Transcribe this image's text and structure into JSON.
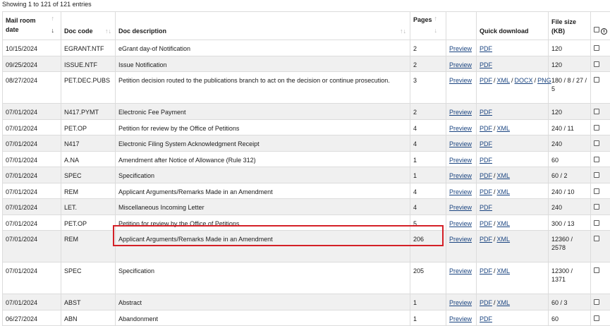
{
  "summary": "Showing 1 to 121 of 121 entries",
  "headers": {
    "mail_room_date": "Mail room date",
    "doc_code": "Doc code",
    "doc_description": "Doc description",
    "pages": "Pages",
    "quick_download": "Quick download",
    "file_size": "File size (KB)"
  },
  "preview_label": "Preview",
  "rows": [
    {
      "date": "10/15/2024",
      "code": "EGRANT.NTF",
      "desc": "eGrant day-of Notification",
      "pages": "2",
      "formats": [
        "PDF"
      ],
      "size": "120"
    },
    {
      "date": "09/25/2024",
      "code": "ISSUE.NTF",
      "desc": "Issue Notification",
      "pages": "2",
      "formats": [
        "PDF"
      ],
      "size": "120"
    },
    {
      "date": "08/27/2024",
      "code": "PET.DEC.PUBS",
      "desc": "Petition decision routed to the publications branch to act on the decision or continue prosecution.",
      "pages": "3",
      "formats": [
        "PDF",
        "XML",
        "DOCX",
        "PNG"
      ],
      "size": "180 / 8 / 27 / 5"
    },
    {
      "date": "07/01/2024",
      "code": "N417.PYMT",
      "desc": "Electronic Fee Payment",
      "pages": "2",
      "formats": [
        "PDF"
      ],
      "size": "120"
    },
    {
      "date": "07/01/2024",
      "code": "PET.OP",
      "desc": "Petition for review by the Office of Petitions",
      "pages": "4",
      "formats": [
        "PDF",
        "XML"
      ],
      "size": "240 / 11"
    },
    {
      "date": "07/01/2024",
      "code": "N417",
      "desc": "Electronic Filing System Acknowledgment Receipt",
      "pages": "4",
      "formats": [
        "PDF"
      ],
      "size": "240"
    },
    {
      "date": "07/01/2024",
      "code": "A.NA",
      "desc": "Amendment after Notice of Allowance (Rule 312)",
      "pages": "1",
      "formats": [
        "PDF"
      ],
      "size": "60"
    },
    {
      "date": "07/01/2024",
      "code": "SPEC",
      "desc": "Specification",
      "pages": "1",
      "formats": [
        "PDF",
        "XML"
      ],
      "size": "60 / 2"
    },
    {
      "date": "07/01/2024",
      "code": "REM",
      "desc": "Applicant Arguments/Remarks Made in an Amendment",
      "pages": "4",
      "formats": [
        "PDF",
        "XML"
      ],
      "size": "240 / 10"
    },
    {
      "date": "07/01/2024",
      "code": "LET.",
      "desc": "Miscellaneous Incoming Letter",
      "pages": "4",
      "formats": [
        "PDF"
      ],
      "size": "240"
    },
    {
      "date": "07/01/2024",
      "code": "PET.OP",
      "desc": "Petition for review by the Office of Petitions",
      "pages": "5",
      "formats": [
        "PDF",
        "XML"
      ],
      "size": "300 / 13"
    },
    {
      "date": "07/01/2024",
      "code": "REM",
      "desc": "Applicant Arguments/Remarks Made in an Amendment",
      "pages": "206",
      "formats": [
        "PDF",
        "XML"
      ],
      "size": "12360 / 2578"
    },
    {
      "date": "07/01/2024",
      "code": "SPEC",
      "desc": "Specification",
      "pages": "205",
      "formats": [
        "PDF",
        "XML"
      ],
      "size": "12300 / 1371"
    },
    {
      "date": "07/01/2024",
      "code": "ABST",
      "desc": "Abstract",
      "pages": "1",
      "formats": [
        "PDF",
        "XML"
      ],
      "size": "60 / 3"
    },
    {
      "date": "06/27/2024",
      "code": "ABN",
      "desc": "Abandonment",
      "pages": "1",
      "formats": [
        "PDF"
      ],
      "size": "60"
    }
  ],
  "colors": {
    "link": "#1a4480",
    "highlight": "#d42027",
    "stripe": "#f0f0f0"
  }
}
